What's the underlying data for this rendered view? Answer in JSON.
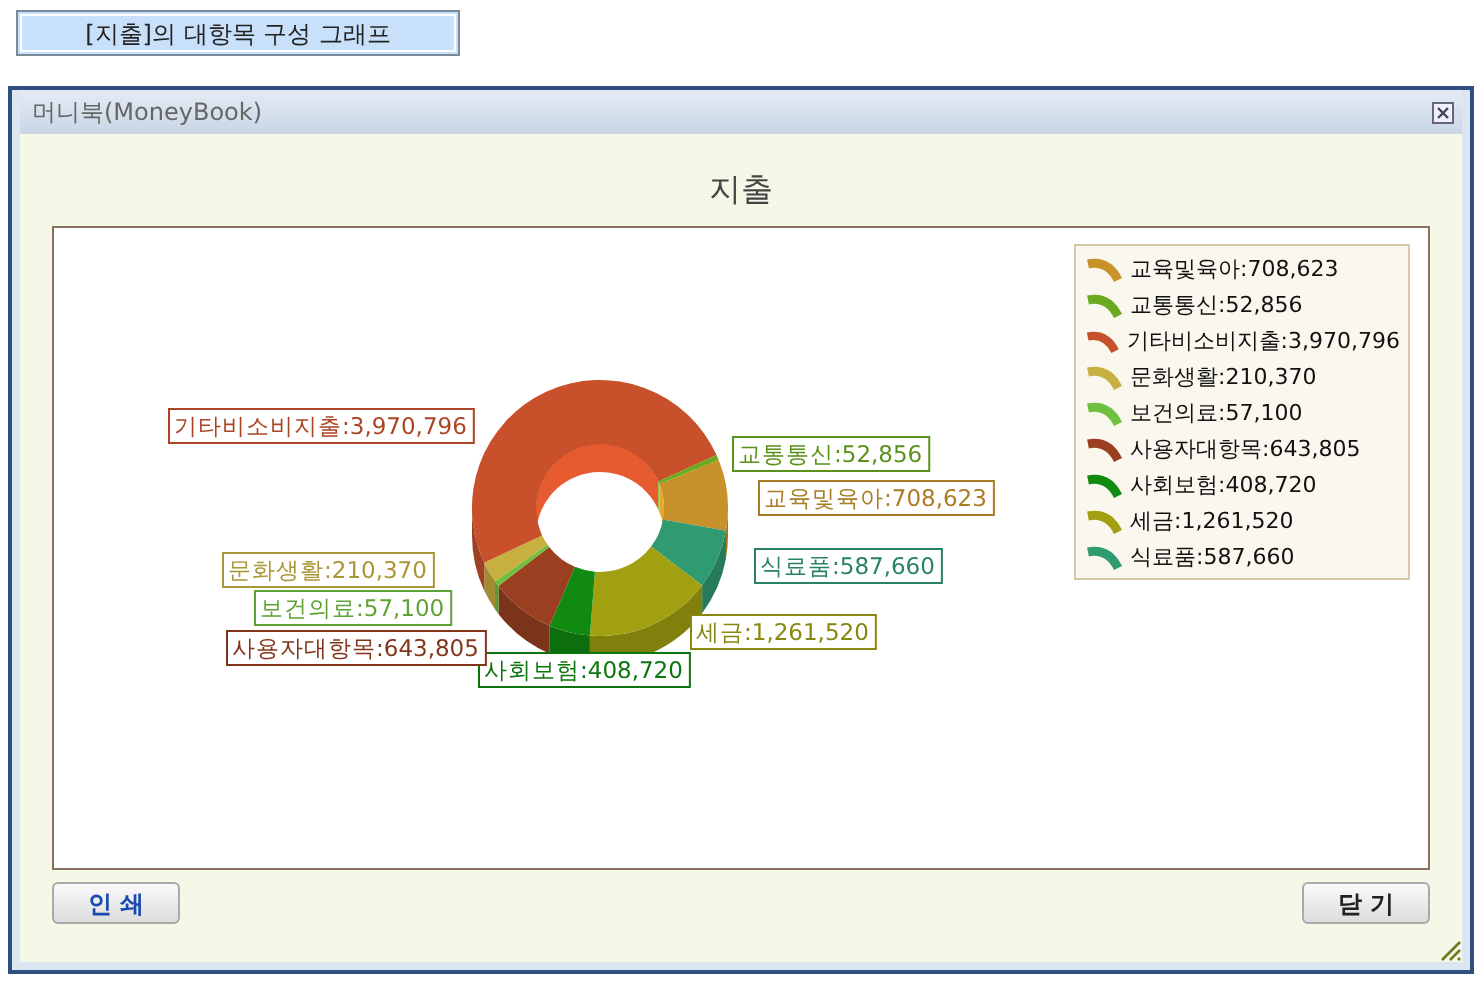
{
  "top_button": {
    "label": "[지출]의 대항목 구성 그래프"
  },
  "window": {
    "title": "머니북(MoneyBook)"
  },
  "chart": {
    "chart_data": {
      "type": "donut",
      "title": "지출",
      "categories": [
        "교육및육아",
        "식료품",
        "세금",
        "사회보험",
        "사용자대항목",
        "보건의료",
        "문화생활",
        "기타비소비지출",
        "교통통신"
      ],
      "values": [
        708623,
        587660,
        1261520,
        408720,
        643805,
        57100,
        210370,
        3970796,
        52856
      ],
      "data_labels": true,
      "value_labels": [
        ":708,623",
        ":587,660",
        ":1,261,520",
        ":408,720",
        ":643,805",
        ":57,100",
        ":210,370",
        ":3,970,796",
        ":52,856"
      ],
      "colors": [
        "#c8922a",
        "#309a70",
        "#a0a010",
        "#108a10",
        "#9a4020",
        "#70c040",
        "#c8b040",
        "#c8502a",
        "#6aaa1e"
      ]
    }
  },
  "legend": [
    {
      "label": "교육및육아:708,623",
      "color": "#c8922a"
    },
    {
      "label": "교통통신:52,856",
      "color": "#6aaa1e"
    },
    {
      "label": "기타비소비지출:3,970,796",
      "color": "#c8502a"
    },
    {
      "label": "문화생활:210,370",
      "color": "#c8b040"
    },
    {
      "label": "보건의료:57,100",
      "color": "#70c040"
    },
    {
      "label": "사용자대항목:643,805",
      "color": "#9a4020"
    },
    {
      "label": "사회보험:408,720",
      "color": "#108a10"
    },
    {
      "label": "세금:1,261,520",
      "color": "#a0a010"
    },
    {
      "label": "식료품:587,660",
      "color": "#309a70"
    }
  ],
  "buttons": [
    {
      "label": "인 쇄",
      "kind": "print"
    },
    {
      "label": "닫 기",
      "kind": "close"
    }
  ]
}
